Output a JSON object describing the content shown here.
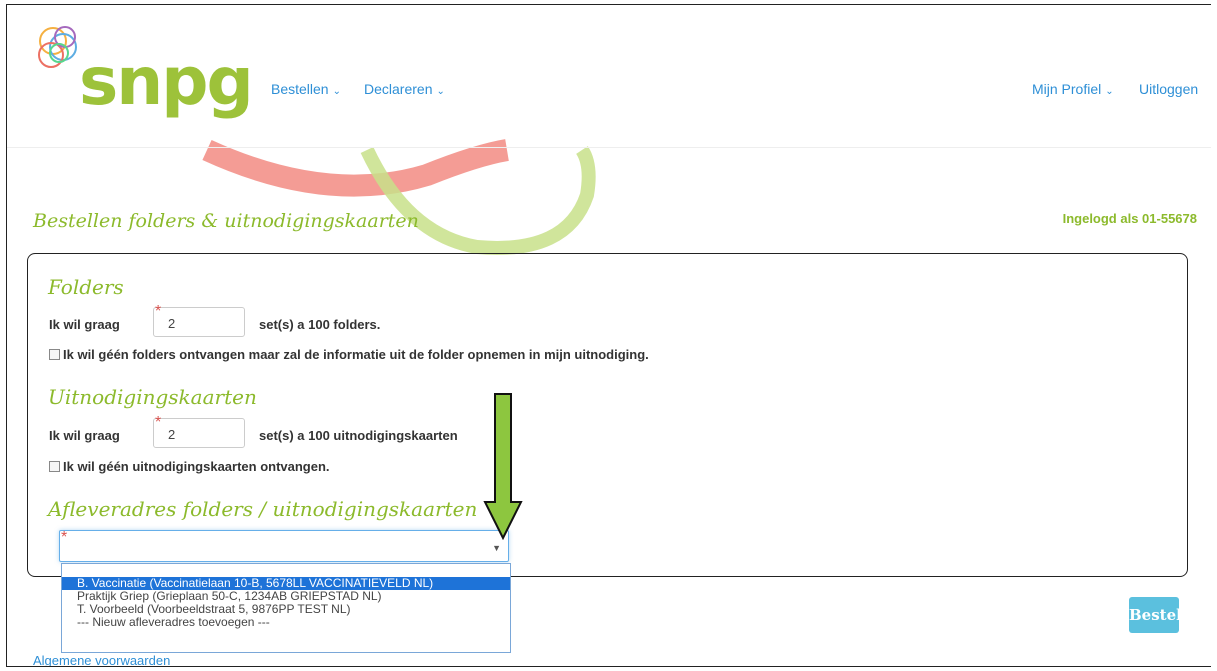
{
  "header": {
    "logo_text": "snpg",
    "nav_left": [
      {
        "label": "Bestellen"
      },
      {
        "label": "Declareren"
      }
    ],
    "nav_right": {
      "profile": "Mijn Profiel",
      "logout": "Uitloggen"
    }
  },
  "page": {
    "title": "Bestellen folders & uitnodigingskaarten",
    "logged_in": "Ingelogd als 01-55678"
  },
  "folders": {
    "heading": "Folders",
    "label": "Ik wil graag",
    "value": "2",
    "suffix": "set(s) a 100 folders.",
    "checkbox_label": "Ik wil géén folders ontvangen maar zal de informatie uit de folder opnemen in mijn uitnodiging."
  },
  "uitnodigingen": {
    "heading": "Uitnodigingskaarten",
    "label": "Ik wil graag",
    "value": "2",
    "suffix": "set(s) a 100 uitnodigingskaarten",
    "checkbox_label": "Ik wil géén uitnodigingskaarten ontvangen."
  },
  "afleveradres": {
    "heading": "Afleveradres folders / uitnodigingskaarten",
    "value": "",
    "options": [
      "",
      "B. Vaccinatie (Vaccinatielaan 10-B, 5678LL VACCINATIEVELD NL)",
      "Praktijk Griep (Grieplaan 50-C, 1234AB GRIEPSTAD NL)",
      "T. Voorbeeld (Voorbeeldstraat 5, 9876PP TEST NL)",
      "--- Nieuw afleveradres toevoegen ---"
    ],
    "highlighted_index": 1
  },
  "actions": {
    "order_button": "Bestel"
  },
  "footer": {
    "terms_link": "Algemene voorwaarden"
  },
  "colors": {
    "brand_green": "#9dc23a",
    "link_blue": "#2e8fd6",
    "button": "#5bc0de",
    "highlight": "#1e73d8",
    "arrow_green": "#8dc63f"
  },
  "icons": {
    "caret": "chevron-down-icon",
    "required": "asterisk-icon",
    "annotation": "down-arrow-icon"
  }
}
